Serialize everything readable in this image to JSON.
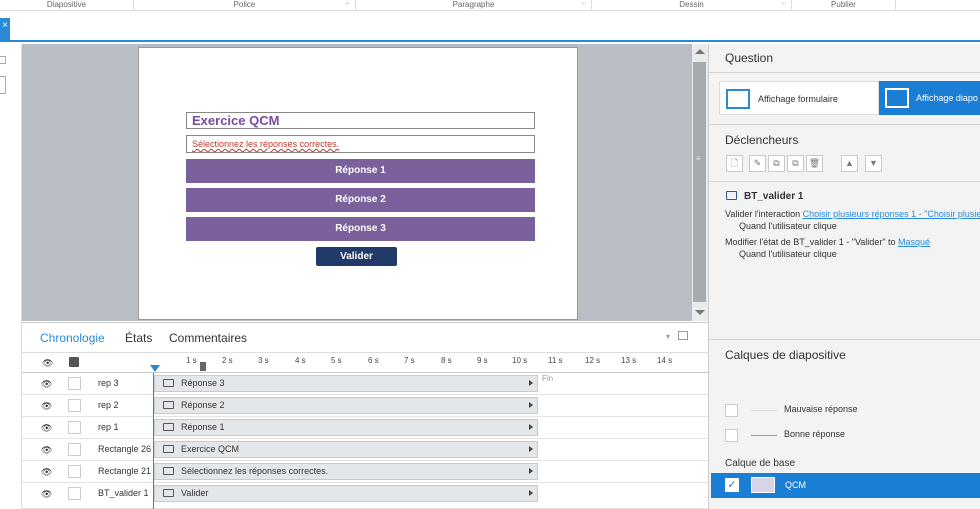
{
  "ribbon": {
    "groups": [
      "Diapositive",
      "Police",
      "Paragraphe",
      "Dessin",
      "Publier"
    ]
  },
  "tabstub": "×",
  "slide": {
    "title": "Exercice QCM",
    "subtitle": "Sélectionnez les réponses correctes.",
    "answers": [
      "Réponse 1",
      "Réponse 2",
      "Réponse 3"
    ],
    "submit": "Valider"
  },
  "timeline": {
    "tabs": [
      "Chronologie",
      "États",
      "Commentaires"
    ],
    "ticks": [
      "1 s",
      "2 s",
      "3 s",
      "4 s",
      "5 s",
      "6 s",
      "7 s",
      "8 s",
      "9 s",
      "10 s",
      "11 s",
      "12 s",
      "13 s",
      "14 s"
    ],
    "end_label": "Fin",
    "rows": [
      {
        "name": "rep 3",
        "bar": "Réponse 3"
      },
      {
        "name": "rep 2",
        "bar": "Réponse 2"
      },
      {
        "name": "rep 1",
        "bar": "Réponse 1"
      },
      {
        "name": "Rectangle 26",
        "bar": "Exercice QCM"
      },
      {
        "name": "Rectangle 21",
        "bar": "Sélectionnez les réponses correctes."
      },
      {
        "name": "BT_valider 1",
        "bar": "Valider"
      }
    ]
  },
  "panel": {
    "question_title": "Question",
    "form_view": "Affichage formulaire",
    "slide_view": "Affichage diapo",
    "triggers_title": "Déclencheurs",
    "trigger_object": "BT_valider 1",
    "trigger1_prefix": "Valider l'interaction",
    "trigger1_link": "Choisir plusieurs réponses 1 - \"Choisir plusie",
    "trigger1_when": "Quand l'utilisateur clique",
    "trigger2_prefix": "Modifier l'état de BT_valider 1 - \"Valider\" to",
    "trigger2_link": "Masqué",
    "trigger2_when": "Quand l'utilisateur clique",
    "layers_title": "Calques de diapositive",
    "layers": [
      "Mauvaise réponse",
      "Bonne réponse"
    ],
    "base_layer_label": "Calque de base",
    "base_layer": "QCM"
  },
  "colors": {
    "accent": "#2b8ad8",
    "answer_bg": "#7b619c",
    "submit_bg": "#213a67",
    "canvas_bg": "#b9bec4"
  }
}
